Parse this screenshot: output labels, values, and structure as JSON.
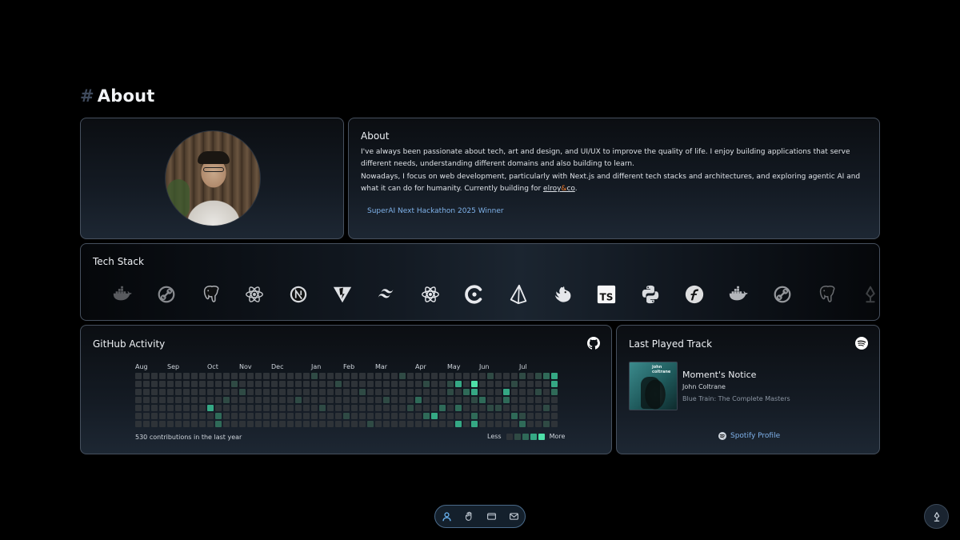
{
  "section": {
    "hash": "#",
    "title": "About"
  },
  "about": {
    "title": "About",
    "p1": "I've always been passionate about tech, art and design, and UI/UX to improve the quality of life. I enjoy building applications that serve different needs, understanding different domains and also building to learn.",
    "p2_prefix": "Nowadays, I focus on web development, particularly with Next.js and different tech stacks and architectures, and exploring agentic AI and what it can do for humanity. Currently building for ",
    "link_a": "elroy",
    "link_amp": "&",
    "link_b": "co",
    "p2_suffix": ".",
    "award": "SuperAI Next Hackathon 2025 Winner"
  },
  "tech": {
    "title": "Tech Stack",
    "icons": [
      "docker-icon",
      "link-icon",
      "postgresql-icon",
      "react-icon",
      "nextjs-icon",
      "vite-icon",
      "tailwind-icon",
      "react-icon",
      "cypress-icon",
      "prisma-icon",
      "nestjs-icon",
      "typescript-icon",
      "python-icon",
      "fastify-icon",
      "docker-icon",
      "link-icon",
      "postgresql-icon",
      "elroy-icon"
    ],
    "ts_label": "TS"
  },
  "github": {
    "title": "GitHub Activity",
    "months": [
      "Aug",
      "Sep",
      "Oct",
      "Nov",
      "Dec",
      "Jan",
      "Feb",
      "Mar",
      "Apr",
      "May",
      "Jun",
      "Jul"
    ],
    "summary": "530 contributions in the last year",
    "legend_less": "Less",
    "legend_more": "More",
    "colors": [
      "#2e3338",
      "#2f4a44",
      "#2f6a58",
      "#35a884",
      "#4ee0a8"
    ]
  },
  "spotify": {
    "title": "Last Played Track",
    "track": "Moment's Notice",
    "artist": "John Coltrane",
    "album": "Blue Train: The Complete Masters",
    "album_art_text": "john coltrane",
    "profile_label": "Spotify Profile"
  },
  "dock": {
    "items": [
      "about-icon",
      "hand-icon",
      "projects-icon",
      "mail-icon"
    ]
  }
}
